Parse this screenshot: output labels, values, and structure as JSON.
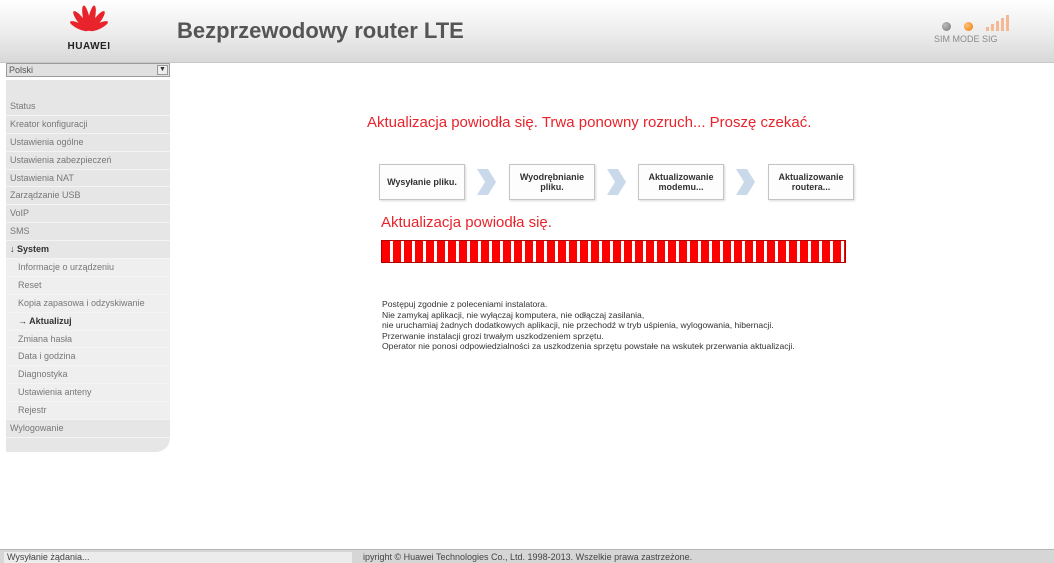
{
  "header": {
    "brand": "HUAWEI",
    "title": "Bezprzewodowy router LTE",
    "status_labels": "SIM MODE  SIG",
    "colors": {
      "brand_red": "#e8232b",
      "mode_led": "#f07800",
      "sig_bars": "#f5b895"
    }
  },
  "sidebar": {
    "language": "Polski",
    "items": [
      {
        "label": "Status"
      },
      {
        "label": "Kreator konfiguracji"
      },
      {
        "label": "Ustawienia ogólne"
      },
      {
        "label": "Ustawienia zabezpieczeń"
      },
      {
        "label": "Ustawienia NAT"
      },
      {
        "label": "Zarządzanie USB"
      },
      {
        "label": "VoIP"
      },
      {
        "label": "SMS"
      },
      {
        "label": "↓ System"
      },
      {
        "label": "Informacje o urządzeniu"
      },
      {
        "label": "Reset"
      },
      {
        "label": "Kopia zapasowa i odzyskiwanie"
      },
      {
        "label": "→ Aktualizuj"
      },
      {
        "label": "Zmiana hasła"
      },
      {
        "label": "Data i godzina"
      },
      {
        "label": "Diagnostyka"
      },
      {
        "label": "Ustawienia anteny"
      },
      {
        "label": "Rejestr"
      },
      {
        "label": "Wylogowanie"
      }
    ]
  },
  "main": {
    "headline": "Aktualizacja powiodła się. Trwa ponowny rozruch... Proszę czekać.",
    "steps": [
      {
        "label": "Wysyłanie pliku."
      },
      {
        "label": "Wyodrębnianie pliku."
      },
      {
        "label": "Aktualizowanie modemu..."
      },
      {
        "label": "Aktualizowanie routera..."
      }
    ],
    "sub_status": "Aktualizacja powiodła się.",
    "progress_percent": 100,
    "notes": [
      "Postępuj zgodnie z poleceniami instalatora.",
      "Nie zamykaj aplikacji, nie wyłączaj komputera, nie odłączaj zasilania,",
      "nie uruchamiaj żadnych dodatkowych aplikacji, nie przechodź w tryb uśpienia, wylogowania, hibernacji.",
      "Przerwanie instalacji grozi trwałym uszkodzeniem sprzętu.",
      "Operator nie ponosi odpowiedzialności za uszkodzenia sprzętu powstałe na wskutek przerwania aktualizacji."
    ]
  },
  "statusbar": {
    "status": "Wysyłanie żądania...",
    "copyright": "ipyright © Huawei Technologies Co., Ltd. 1998-2013. Wszelkie prawa zastrzeżone."
  }
}
